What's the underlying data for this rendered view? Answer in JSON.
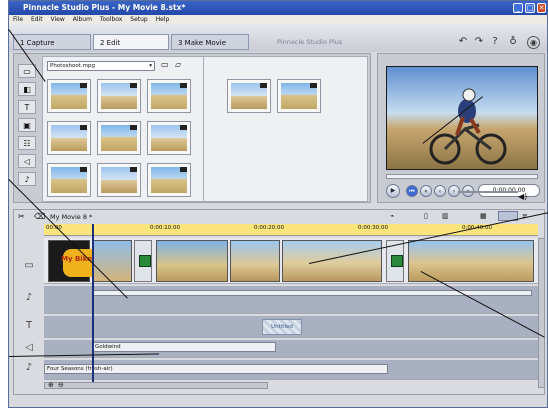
{
  "window": {
    "title": "Pinnacle Studio Plus - My Movie 8.stx*",
    "minimize_symbol": "_",
    "maximize_symbol": "□",
    "close_symbol": "✕"
  },
  "menu": [
    "File",
    "Edit",
    "View",
    "Album",
    "Toolbox",
    "Setup",
    "Help"
  ],
  "modes": {
    "capture": "1 Capture",
    "edit": "2 Edit",
    "make_movie": "3 Make Movie",
    "brand": "Pinnacle Studio Plus"
  },
  "album": {
    "dropdown_value": "Photoshoot.mpg"
  },
  "player": {
    "timecode": "0:00:00.00"
  },
  "timeline": {
    "project_name": "My Movie 8 *",
    "ruler_ticks": [
      "00:00",
      "0:00:10.00",
      "0:00:20.00",
      "0:00:30.00",
      "0:00:40.00"
    ],
    "title_clip_text": "My Bike",
    "title_overlay_text": "Untitled",
    "sound_clip": "Goldwind",
    "music_clip": "Four Seasons (fresh-air)"
  },
  "colors": {
    "titlebar": "#2a52b4",
    "ruler": "#fbe47b",
    "transition": "#2a8a3c"
  }
}
